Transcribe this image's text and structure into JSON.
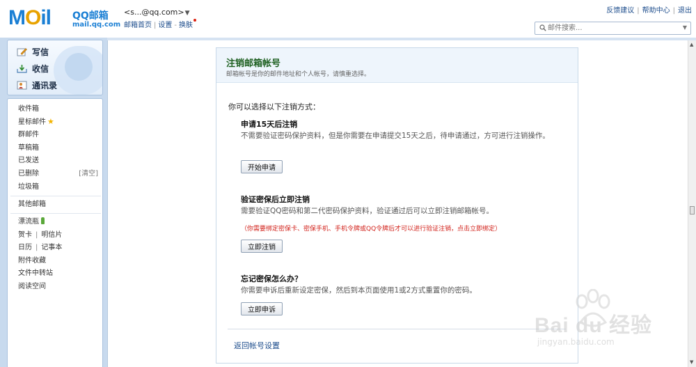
{
  "header": {
    "logo_mark": "M",
    "logo_mark_o": "O",
    "logo_mark_rest": "il",
    "logo_cn": "QQ邮箱",
    "logo_domain": "mail.qq.com",
    "user_line": "<s...@qq.com>",
    "user_links": [
      "邮箱首页",
      "设置",
      "换肤"
    ],
    "top_links": [
      "反馈建议",
      "帮助中心",
      "退出"
    ],
    "search_placeholder": "邮件搜索..."
  },
  "sidebar": {
    "actions": [
      {
        "label": "写信",
        "icon": "compose-icon"
      },
      {
        "label": "收信",
        "icon": "inbox-download-icon"
      },
      {
        "label": "通讯录",
        "icon": "contacts-icon"
      }
    ],
    "folders": [
      "收件箱",
      "星标邮件",
      "群邮件",
      "草稿箱",
      "已发送",
      "已删除",
      "垃圾箱"
    ],
    "clear_label": "[清空]",
    "other_mail": "其他邮箱",
    "apps": {
      "bottle": "漂流瓶",
      "card": "贺卡",
      "postcard": "明信片",
      "calendar": "日历",
      "notes": "记事本",
      "attachments": "附件收藏",
      "transfer": "文件中转站",
      "reading": "阅读空间"
    }
  },
  "panel": {
    "title": "注销邮箱帐号",
    "subtitle": "邮箱帐号是你的邮件地址和个人帐号，请慎重选择。",
    "intro": "你可以选择以下注销方式：",
    "options": [
      {
        "title": "申请15天后注销",
        "desc": "不需要验证密码保护资料，但是你需要在申请提交15天之后，待申请通过，方可进行注销操作。",
        "button": "开始申请"
      },
      {
        "title": "验证密保后立即注销",
        "desc": "需要验证QQ密码和第二代密码保护资料，验证通过后可以立即注销邮箱帐号。",
        "warn": "（你需要绑定密保卡、密保手机、手机令牌或QQ令牌后才可以进行验证注销，点击立即绑定）",
        "button": "立即注销"
      },
      {
        "title": "忘记密保怎么办？",
        "desc": "你需要申诉后重新设定密保，然后到本页面使用1或2方式重置你的密码。",
        "button": "立即申诉"
      }
    ],
    "back_link": "返回帐号设置"
  },
  "watermark": {
    "text": "Bai du 经验",
    "url": "jingyan.baidu.com"
  }
}
